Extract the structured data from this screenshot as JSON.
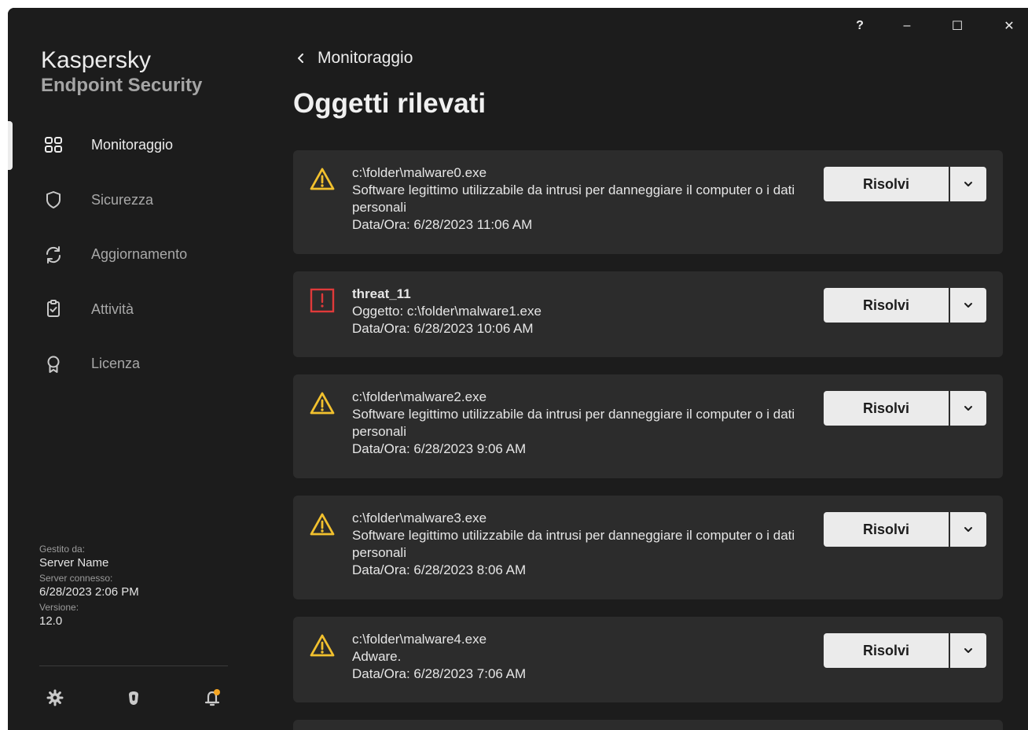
{
  "window": {
    "help_label": "?",
    "minimize_label": "–",
    "maximize_label": "☐",
    "close_label": "✕"
  },
  "brand": {
    "name": "Kaspersky",
    "product": "Endpoint Security"
  },
  "nav": {
    "items": [
      {
        "label": "Monitoraggio",
        "icon": "dashboard-icon",
        "active": true
      },
      {
        "label": "Sicurezza",
        "icon": "shield-icon",
        "active": false
      },
      {
        "label": "Aggiornamento",
        "icon": "refresh-icon",
        "active": false
      },
      {
        "label": "Attività",
        "icon": "clipboard-check-icon",
        "active": false
      },
      {
        "label": "Licenza",
        "icon": "license-ribbon-icon",
        "active": false
      }
    ]
  },
  "meta": {
    "managed_by_label": "Gestito da:",
    "managed_by_value": "Server Name",
    "server_connected_label": "Server connesso:",
    "server_connected_value": "6/28/2023 2:06 PM",
    "version_label": "Versione:",
    "version_value": "12.0"
  },
  "footer_icons": [
    "gear-icon",
    "kaspersky-logo-icon",
    "notification-bell-icon"
  ],
  "header": {
    "back_label": "Monitoraggio",
    "title": "Oggetti rilevati"
  },
  "detections": [
    {
      "severity": "warning",
      "title": "c:\\folder\\malware0.exe",
      "description": "Software legittimo utilizzabile da intrusi per danneggiare il computer o i dati personali",
      "datetime": "Data/Ora: 6/28/2023 11:06 AM",
      "action": "Risolvi"
    },
    {
      "severity": "critical",
      "title": "threat_11",
      "description": "Oggetto: c:\\folder\\malware1.exe",
      "datetime": "Data/Ora: 6/28/2023 10:06 AM",
      "action": "Risolvi"
    },
    {
      "severity": "warning",
      "title": "c:\\folder\\malware2.exe",
      "description": "Software legittimo utilizzabile da intrusi per danneggiare il computer o i dati personali",
      "datetime": "Data/Ora: 6/28/2023 9:06 AM",
      "action": "Risolvi"
    },
    {
      "severity": "warning",
      "title": "c:\\folder\\malware3.exe",
      "description": "Software legittimo utilizzabile da intrusi per danneggiare il computer o i dati personali",
      "datetime": "Data/Ora: 6/28/2023 8:06 AM",
      "action": "Risolvi"
    },
    {
      "severity": "warning",
      "title": "c:\\folder\\malware4.exe",
      "description": "Adware.",
      "datetime": "Data/Ora: 6/28/2023 7:06 AM",
      "action": "Risolvi"
    }
  ],
  "colors": {
    "background": "#1c1c1c",
    "card": "#2c2c2c",
    "warning": "#f2c12e",
    "critical": "#e03a3a",
    "notification_dot": "#f5a623"
  }
}
